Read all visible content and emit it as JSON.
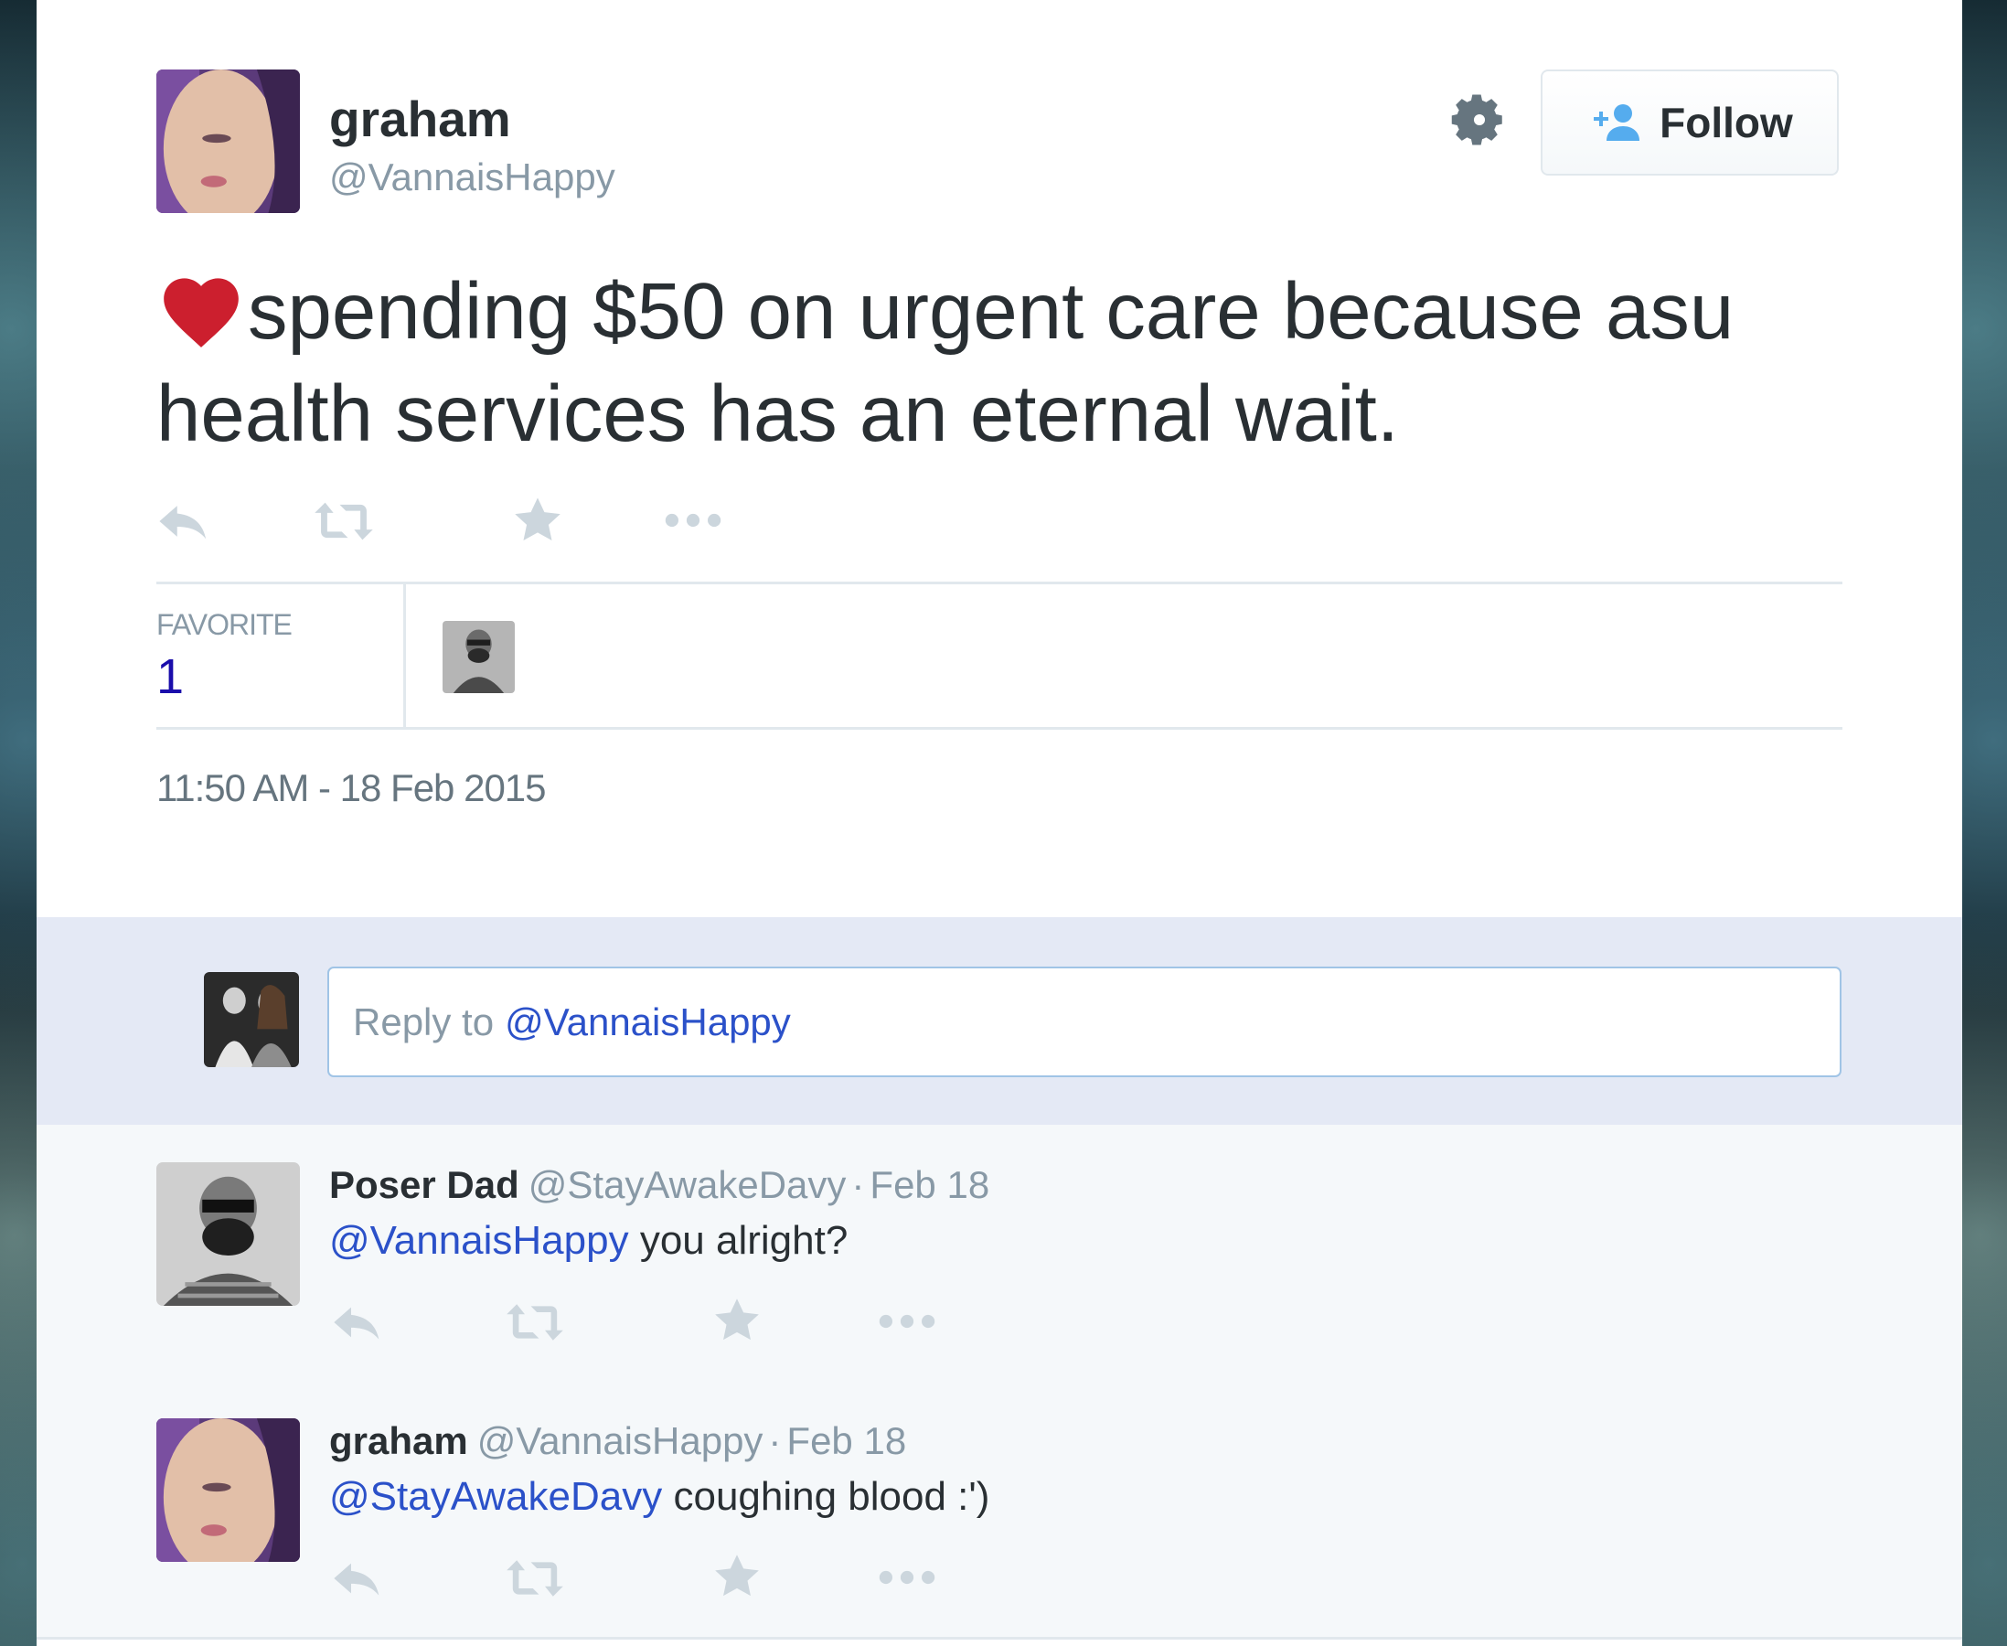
{
  "tweet": {
    "author_name": "graham",
    "author_handle": "@VannaisHappy",
    "follow_label": "Follow",
    "text": "spending $50 on urgent care because asu health services has an eternal wait.",
    "favorites_label": "FAVORITE",
    "favorites_count": "1",
    "timestamp": "11:50 AM - 18 Feb 2015"
  },
  "reply_box": {
    "prefix": "Reply to",
    "mention": "@VannaisHappy"
  },
  "replies": [
    {
      "name": "Poser Dad",
      "handle": "@StayAwakeDavy",
      "dot": "·",
      "time": "Feb 18",
      "mention": "@VannaisHappy",
      "text": "you alright?"
    },
    {
      "name": "graham",
      "handle": "@VannaisHappy",
      "dot": "·",
      "time": "Feb 18",
      "mention": "@StayAwakeDavy",
      "text": "coughing blood :')"
    }
  ],
  "icons": {
    "heart": "heart-icon",
    "gear": "gear-icon",
    "follow": "add-user-icon",
    "reply": "reply-icon",
    "retweet": "retweet-icon",
    "favorite": "star-icon",
    "more": "more-icon"
  },
  "colors": {
    "link": "#2b51c9",
    "heart": "#cc1f2e",
    "reply_bar": "#e4e9f5",
    "action_gray": "#ccd6dd"
  }
}
